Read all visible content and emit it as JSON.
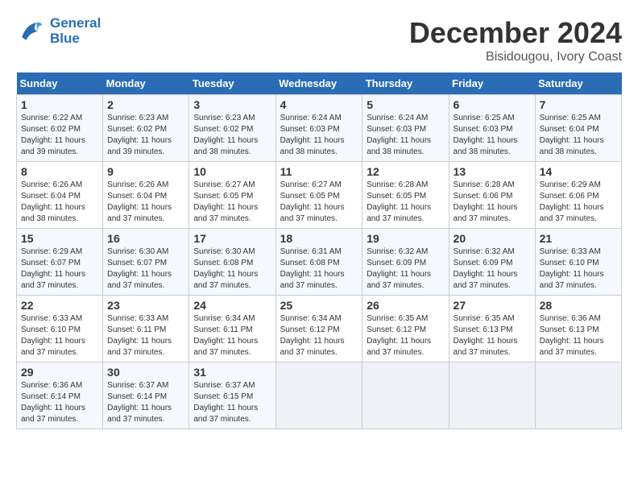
{
  "header": {
    "logo_line1": "General",
    "logo_line2": "Blue",
    "month": "December 2024",
    "location": "Bisidougou, Ivory Coast"
  },
  "weekdays": [
    "Sunday",
    "Monday",
    "Tuesday",
    "Wednesday",
    "Thursday",
    "Friday",
    "Saturday"
  ],
  "weeks": [
    [
      {
        "day": "1",
        "info": "Sunrise: 6:22 AM\nSunset: 6:02 PM\nDaylight: 11 hours\nand 39 minutes."
      },
      {
        "day": "2",
        "info": "Sunrise: 6:23 AM\nSunset: 6:02 PM\nDaylight: 11 hours\nand 39 minutes."
      },
      {
        "day": "3",
        "info": "Sunrise: 6:23 AM\nSunset: 6:02 PM\nDaylight: 11 hours\nand 38 minutes."
      },
      {
        "day": "4",
        "info": "Sunrise: 6:24 AM\nSunset: 6:03 PM\nDaylight: 11 hours\nand 38 minutes."
      },
      {
        "day": "5",
        "info": "Sunrise: 6:24 AM\nSunset: 6:03 PM\nDaylight: 11 hours\nand 38 minutes."
      },
      {
        "day": "6",
        "info": "Sunrise: 6:25 AM\nSunset: 6:03 PM\nDaylight: 11 hours\nand 38 minutes."
      },
      {
        "day": "7",
        "info": "Sunrise: 6:25 AM\nSunset: 6:04 PM\nDaylight: 11 hours\nand 38 minutes."
      }
    ],
    [
      {
        "day": "8",
        "info": "Sunrise: 6:26 AM\nSunset: 6:04 PM\nDaylight: 11 hours\nand 38 minutes."
      },
      {
        "day": "9",
        "info": "Sunrise: 6:26 AM\nSunset: 6:04 PM\nDaylight: 11 hours\nand 37 minutes."
      },
      {
        "day": "10",
        "info": "Sunrise: 6:27 AM\nSunset: 6:05 PM\nDaylight: 11 hours\nand 37 minutes."
      },
      {
        "day": "11",
        "info": "Sunrise: 6:27 AM\nSunset: 6:05 PM\nDaylight: 11 hours\nand 37 minutes."
      },
      {
        "day": "12",
        "info": "Sunrise: 6:28 AM\nSunset: 6:05 PM\nDaylight: 11 hours\nand 37 minutes."
      },
      {
        "day": "13",
        "info": "Sunrise: 6:28 AM\nSunset: 6:06 PM\nDaylight: 11 hours\nand 37 minutes."
      },
      {
        "day": "14",
        "info": "Sunrise: 6:29 AM\nSunset: 6:06 PM\nDaylight: 11 hours\nand 37 minutes."
      }
    ],
    [
      {
        "day": "15",
        "info": "Sunrise: 6:29 AM\nSunset: 6:07 PM\nDaylight: 11 hours\nand 37 minutes."
      },
      {
        "day": "16",
        "info": "Sunrise: 6:30 AM\nSunset: 6:07 PM\nDaylight: 11 hours\nand 37 minutes."
      },
      {
        "day": "17",
        "info": "Sunrise: 6:30 AM\nSunset: 6:08 PM\nDaylight: 11 hours\nand 37 minutes."
      },
      {
        "day": "18",
        "info": "Sunrise: 6:31 AM\nSunset: 6:08 PM\nDaylight: 11 hours\nand 37 minutes."
      },
      {
        "day": "19",
        "info": "Sunrise: 6:32 AM\nSunset: 6:09 PM\nDaylight: 11 hours\nand 37 minutes."
      },
      {
        "day": "20",
        "info": "Sunrise: 6:32 AM\nSunset: 6:09 PM\nDaylight: 11 hours\nand 37 minutes."
      },
      {
        "day": "21",
        "info": "Sunrise: 6:33 AM\nSunset: 6:10 PM\nDaylight: 11 hours\nand 37 minutes."
      }
    ],
    [
      {
        "day": "22",
        "info": "Sunrise: 6:33 AM\nSunset: 6:10 PM\nDaylight: 11 hours\nand 37 minutes."
      },
      {
        "day": "23",
        "info": "Sunrise: 6:33 AM\nSunset: 6:11 PM\nDaylight: 11 hours\nand 37 minutes."
      },
      {
        "day": "24",
        "info": "Sunrise: 6:34 AM\nSunset: 6:11 PM\nDaylight: 11 hours\nand 37 minutes."
      },
      {
        "day": "25",
        "info": "Sunrise: 6:34 AM\nSunset: 6:12 PM\nDaylight: 11 hours\nand 37 minutes."
      },
      {
        "day": "26",
        "info": "Sunrise: 6:35 AM\nSunset: 6:12 PM\nDaylight: 11 hours\nand 37 minutes."
      },
      {
        "day": "27",
        "info": "Sunrise: 6:35 AM\nSunset: 6:13 PM\nDaylight: 11 hours\nand 37 minutes."
      },
      {
        "day": "28",
        "info": "Sunrise: 6:36 AM\nSunset: 6:13 PM\nDaylight: 11 hours\nand 37 minutes."
      }
    ],
    [
      {
        "day": "29",
        "info": "Sunrise: 6:36 AM\nSunset: 6:14 PM\nDaylight: 11 hours\nand 37 minutes."
      },
      {
        "day": "30",
        "info": "Sunrise: 6:37 AM\nSunset: 6:14 PM\nDaylight: 11 hours\nand 37 minutes."
      },
      {
        "day": "31",
        "info": "Sunrise: 6:37 AM\nSunset: 6:15 PM\nDaylight: 11 hours\nand 37 minutes."
      },
      {
        "day": "",
        "info": ""
      },
      {
        "day": "",
        "info": ""
      },
      {
        "day": "",
        "info": ""
      },
      {
        "day": "",
        "info": ""
      }
    ]
  ]
}
